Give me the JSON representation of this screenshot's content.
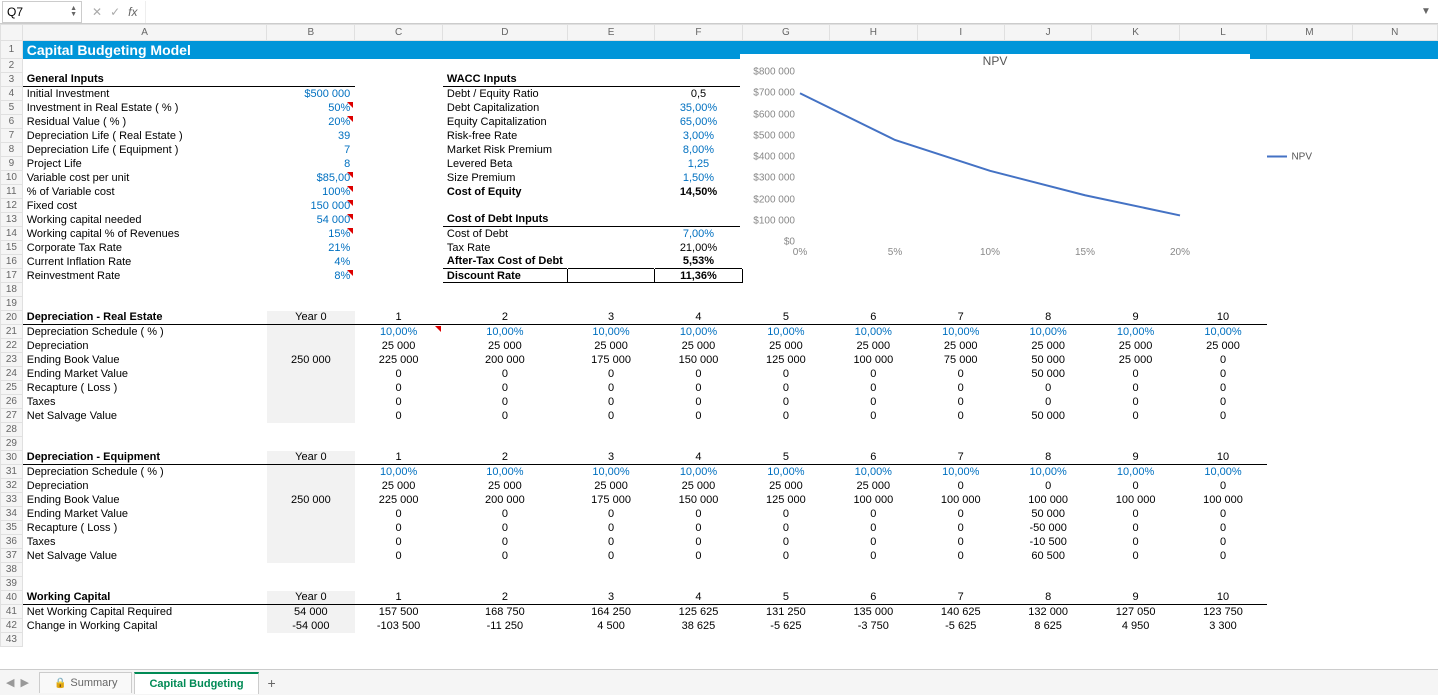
{
  "namebox": "Q7",
  "title": "Capital Budgeting Model",
  "general_inputs_header": "General Inputs",
  "wacc_inputs_header": "WACC Inputs",
  "cost_debt_header": "Cost of Debt Inputs",
  "gi": {
    "initial_investment_l": "Initial Investment",
    "initial_investment_v": "$500 000",
    "inv_real_estate_l": "Investment in Real Estate ( % )",
    "inv_real_estate_v": "50%",
    "residual_value_l": "Residual Value ( % )",
    "residual_value_v": "20%",
    "dep_life_re_l": "Depreciation Life ( Real Estate )",
    "dep_life_re_v": "39",
    "dep_life_eq_l": "Depreciation Life ( Equipment )",
    "dep_life_eq_v": "7",
    "project_life_l": "Project Life",
    "project_life_v": "8",
    "var_cost_unit_l": "Variable cost per unit",
    "var_cost_unit_v": "$85,00",
    "pct_var_cost_l": "% of Variable cost",
    "pct_var_cost_v": "100%",
    "fixed_cost_l": "Fixed cost",
    "fixed_cost_v": "150 000",
    "wc_needed_l": "Working capital needed",
    "wc_needed_v": "54 000",
    "wc_pct_rev_l": "Working capital % of Revenues",
    "wc_pct_rev_v": "15%",
    "corp_tax_l": "Corporate Tax Rate",
    "corp_tax_v": "21%",
    "inflation_l": "Current Inflation Rate",
    "inflation_v": "4%",
    "reinvest_l": "Reinvestment Rate",
    "reinvest_v": "8%"
  },
  "wacc": {
    "de_ratio_l": "Debt / Equity Ratio",
    "de_ratio_v": "0,5",
    "debt_cap_l": "Debt Capitalization",
    "debt_cap_v": "35,00%",
    "equity_cap_l": "Equity Capitalization",
    "equity_cap_v": "65,00%",
    "rf_rate_l": "Risk-free Rate",
    "rf_rate_v": "3,00%",
    "mrp_l": "Market Risk Premium",
    "mrp_v": "8,00%",
    "lbeta_l": "Levered Beta",
    "lbeta_v": "1,25",
    "size_prem_l": "Size Premium",
    "size_prem_v": "1,50%",
    "coe_l": "Cost of Equity",
    "coe_v": "14,50%"
  },
  "cod": {
    "cod_l": "Cost of Debt",
    "cod_v": "7,00%",
    "tax_l": "Tax Rate",
    "tax_v": "21,00%",
    "at_cod_l": "After-Tax Cost of Debt",
    "at_cod_v": "5,53%",
    "disc_l": "Discount Rate",
    "disc_v": "11,36%"
  },
  "year0": "Year 0",
  "years": [
    "1",
    "2",
    "3",
    "4",
    "5",
    "6",
    "7",
    "8",
    "9",
    "10"
  ],
  "dep_re_header": "Depreciation - Real Estate",
  "dep_eq_header": "Depreciation - Equipment",
  "row_labels": {
    "sched": "Depreciation Schedule ( % )",
    "dep": "Depreciation",
    "ebv": "Ending Book Value",
    "emv": "Ending Market Value",
    "recap": "Recapture ( Loss )",
    "taxes": "Taxes",
    "nsv": "Net Salvage Value"
  },
  "dep_re": {
    "sched": [
      "10,00%",
      "10,00%",
      "10,00%",
      "10,00%",
      "10,00%",
      "10,00%",
      "10,00%",
      "10,00%",
      "10,00%",
      "10,00%"
    ],
    "dep": [
      "25 000",
      "25 000",
      "25 000",
      "25 000",
      "25 000",
      "25 000",
      "25 000",
      "25 000",
      "25 000",
      "25 000"
    ],
    "y0": "250 000",
    "ebv": [
      "225 000",
      "200 000",
      "175 000",
      "150 000",
      "125 000",
      "100 000",
      "75 000",
      "50 000",
      "25 000",
      "0"
    ],
    "emv": [
      "0",
      "0",
      "0",
      "0",
      "0",
      "0",
      "0",
      "50 000",
      "0",
      "0"
    ],
    "recap": [
      "0",
      "0",
      "0",
      "0",
      "0",
      "0",
      "0",
      "0",
      "0",
      "0"
    ],
    "taxes": [
      "0",
      "0",
      "0",
      "0",
      "0",
      "0",
      "0",
      "0",
      "0",
      "0"
    ],
    "nsv": [
      "0",
      "0",
      "0",
      "0",
      "0",
      "0",
      "0",
      "50 000",
      "0",
      "0"
    ]
  },
  "dep_eq": {
    "sched": [
      "10,00%",
      "10,00%",
      "10,00%",
      "10,00%",
      "10,00%",
      "10,00%",
      "10,00%",
      "10,00%",
      "10,00%",
      "10,00%"
    ],
    "dep": [
      "25 000",
      "25 000",
      "25 000",
      "25 000",
      "25 000",
      "25 000",
      "0",
      "0",
      "0",
      "0"
    ],
    "y0": "250 000",
    "ebv": [
      "225 000",
      "200 000",
      "175 000",
      "150 000",
      "125 000",
      "100 000",
      "100 000",
      "100 000",
      "100 000",
      "100 000"
    ],
    "emv": [
      "0",
      "0",
      "0",
      "0",
      "0",
      "0",
      "0",
      "50 000",
      "0",
      "0"
    ],
    "recap": [
      "0",
      "0",
      "0",
      "0",
      "0",
      "0",
      "0",
      "-50 000",
      "0",
      "0"
    ],
    "taxes": [
      "0",
      "0",
      "0",
      "0",
      "0",
      "0",
      "0",
      "-10 500",
      "0",
      "0"
    ],
    "nsv": [
      "0",
      "0",
      "0",
      "0",
      "0",
      "0",
      "0",
      "60 500",
      "0",
      "0"
    ]
  },
  "wc_header": "Working Capital",
  "wc": {
    "req_l": "Net Working Capital Required",
    "chg_l": "Change in Working Capital",
    "req_y0": "54 000",
    "chg_y0": "-54 000",
    "req": [
      "157 500",
      "168 750",
      "164 250",
      "125 625",
      "131 250",
      "135 000",
      "140 625",
      "132 000",
      "127 050",
      "123 750"
    ],
    "chg": [
      "-103 500",
      "-11 250",
      "4 500",
      "38 625",
      "-5 625",
      "-3 750",
      "-5 625",
      "8 625",
      "4 950",
      "3 300"
    ]
  },
  "chart_data": {
    "type": "line",
    "title": "NPV",
    "x": [
      0,
      5,
      10,
      15,
      20
    ],
    "x_labels": [
      "0%",
      "5%",
      "10%",
      "15%",
      "20%"
    ],
    "y_ticks": [
      0,
      100000,
      200000,
      300000,
      400000,
      500000,
      600000,
      700000,
      800000
    ],
    "y_labels": [
      "$0",
      "$100 000",
      "$200 000",
      "$300 000",
      "$400 000",
      "$500 000",
      "$600 000",
      "$700 000",
      "$800 000"
    ],
    "series": [
      {
        "name": "NPV",
        "values": [
          700000,
          480000,
          335000,
          220000,
          125000
        ]
      }
    ]
  },
  "tabs": {
    "summary": "Summary",
    "active": "Capital Budgeting"
  },
  "cols": [
    "A",
    "B",
    "C",
    "D",
    "E",
    "F",
    "G",
    "H",
    "I",
    "J",
    "K",
    "L",
    "M",
    "N"
  ]
}
